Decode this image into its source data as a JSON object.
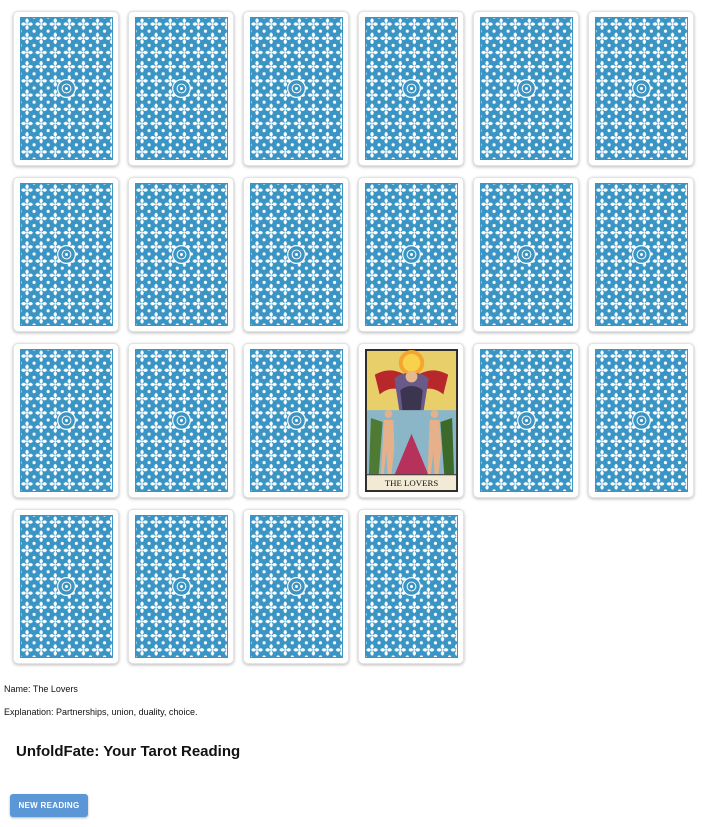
{
  "cards": {
    "columns": 6,
    "count": 22,
    "revealed_index": 15,
    "revealed_title": "THE LOVERS"
  },
  "selected": {
    "name_text": "Name: The Lovers",
    "explanation_text": "Explanation: Partnerships, union, duality, choice."
  },
  "app": {
    "title": "UnfoldFate: Your Tarot Reading",
    "new_reading_label": "NEW READING"
  },
  "colors": {
    "card_back_pattern": "#3b95c4",
    "button": "#5b97d6"
  }
}
